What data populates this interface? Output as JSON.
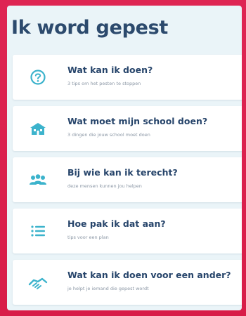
{
  "page": {
    "title": "Ik word gepest"
  },
  "menu": {
    "items": [
      {
        "label": "Wat kan ik doen?",
        "sub": "3 tips om het pesten te stoppen",
        "icon": "question-icon"
      },
      {
        "label": "Wat moet mijn school doen?",
        "sub": "3 dingen die jouw school moet doen",
        "icon": "school-icon"
      },
      {
        "label": "Bij wie kan ik terecht?",
        "sub": "deze mensen kunnen jou helpen",
        "icon": "people-icon"
      },
      {
        "label": "Hoe pak ik dat aan?",
        "sub": "tips voor een plan",
        "icon": "list-icon"
      },
      {
        "label": "Wat kan ik doen voor een ander?",
        "sub": "je helpt je iemand die gepest wordt",
        "icon": "handshake-icon"
      }
    ]
  },
  "colors": {
    "frame": "#d91e4a",
    "screen_bg": "#eaf4f8",
    "title": "#2c4a6d",
    "icon_accent": "#3cb3cc"
  }
}
